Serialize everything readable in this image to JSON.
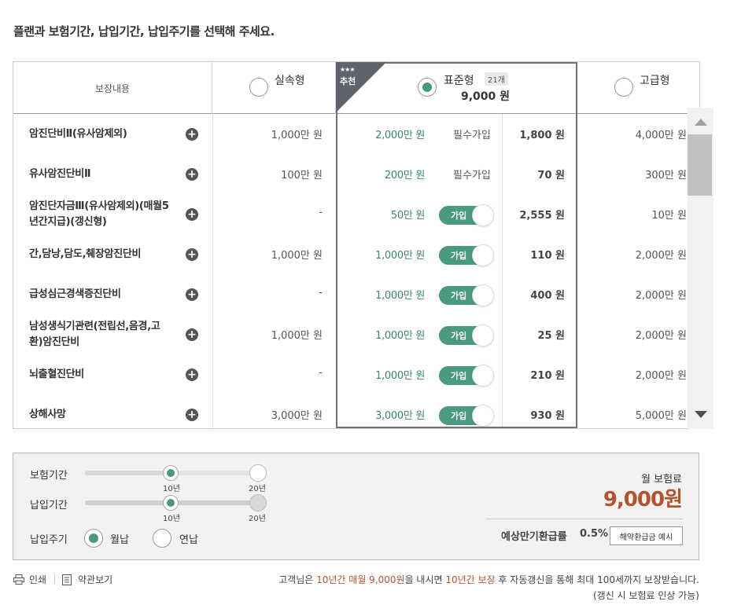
{
  "instruction": "플랜과 보험기간, 납입기간, 납입주기를 선택해 주세요.",
  "table": {
    "label_header": "보장내용",
    "plans": [
      {
        "name": "실속형",
        "selected": false
      },
      {
        "name": "표준형",
        "selected": true,
        "badge": "21개",
        "price": "9,000 원",
        "ribbon_stars": "★★★",
        "ribbon_text": "추천"
      },
      {
        "name": "고급형",
        "selected": false
      }
    ],
    "rows": [
      {
        "label": "암진단비Ⅱ(유사암제외)",
        "basic": "1,000만 원",
        "standard": "2,000만 원",
        "std_status": "필수가입",
        "std_price": "1,800 원",
        "premium": "4,000만 원"
      },
      {
        "label": "유사암진단비Ⅱ",
        "basic": "100만 원",
        "standard": "200만 원",
        "std_status": "필수가입",
        "std_price": "70 원",
        "premium": "300만 원"
      },
      {
        "label": "암진단자금Ⅲ(유사암제외)(매월5년간지급)(갱신형)",
        "basic": "-",
        "standard": "50만 원",
        "std_status": "가입",
        "std_price": "2,555 원",
        "premium": "10만 원"
      },
      {
        "label": "간,담낭,담도,췌장암진단비",
        "basic": "1,000만 원",
        "standard": "1,000만 원",
        "std_status": "가입",
        "std_price": "110 원",
        "premium": "2,000만 원"
      },
      {
        "label": "급성심근경색증진단비",
        "basic": "-",
        "standard": "1,000만 원",
        "std_status": "가입",
        "std_price": "400 원",
        "premium": "2,000만 원"
      },
      {
        "label": "남성생식기관련(전립선,음경,고환)암진단비",
        "basic": "1,000만 원",
        "standard": "1,000만 원",
        "std_status": "가입",
        "std_price": "25 원",
        "premium": "2,000만 원"
      },
      {
        "label": "뇌출혈진단비",
        "basic": "-",
        "standard": "1,000만 원",
        "std_status": "가입",
        "std_price": "210 원",
        "premium": "2,000만 원"
      },
      {
        "label": "상해사망",
        "basic": "3,000만 원",
        "standard": "3,000만 원",
        "std_status": "가입",
        "std_price": "930 원",
        "premium": "5,000만 원"
      }
    ],
    "add_glyph": "+"
  },
  "summary": {
    "insurance_period_label": "보험기간",
    "payment_period_label": "납입기간",
    "payment_cycle_label": "납입주기",
    "insurance_period": {
      "ticks": [
        "10년",
        "20년"
      ],
      "selected": "10년"
    },
    "payment_period": {
      "ticks": [
        "10년",
        "20년"
      ],
      "selected": "10년"
    },
    "cycle_options": [
      {
        "label": "월납",
        "selected": true
      },
      {
        "label": "연납",
        "selected": false
      }
    ],
    "monthly_label": "월 보험료",
    "monthly_value": "9,000원",
    "refund_label": "예상만기환급률",
    "refund_rate": "0.5%",
    "refund_button": "해약환급금 예시"
  },
  "footer": {
    "print": "인쇄",
    "terms": "약관보기",
    "notice_prefix": "고객님은 ",
    "notice_hl1": "10년간 매월 9,000원",
    "notice_mid": "을 내시면 ",
    "notice_hl2": "10년간 보장",
    "notice_suffix": " 후 자동갱신을 통해 최대 100세까지 보장받습니다.",
    "notice_line2": "(갱신 시 보험료 인상 가능)"
  },
  "colors": {
    "accent": "#4a9a82",
    "highlight": "#b5532e",
    "ribbon": "#5e636e"
  }
}
